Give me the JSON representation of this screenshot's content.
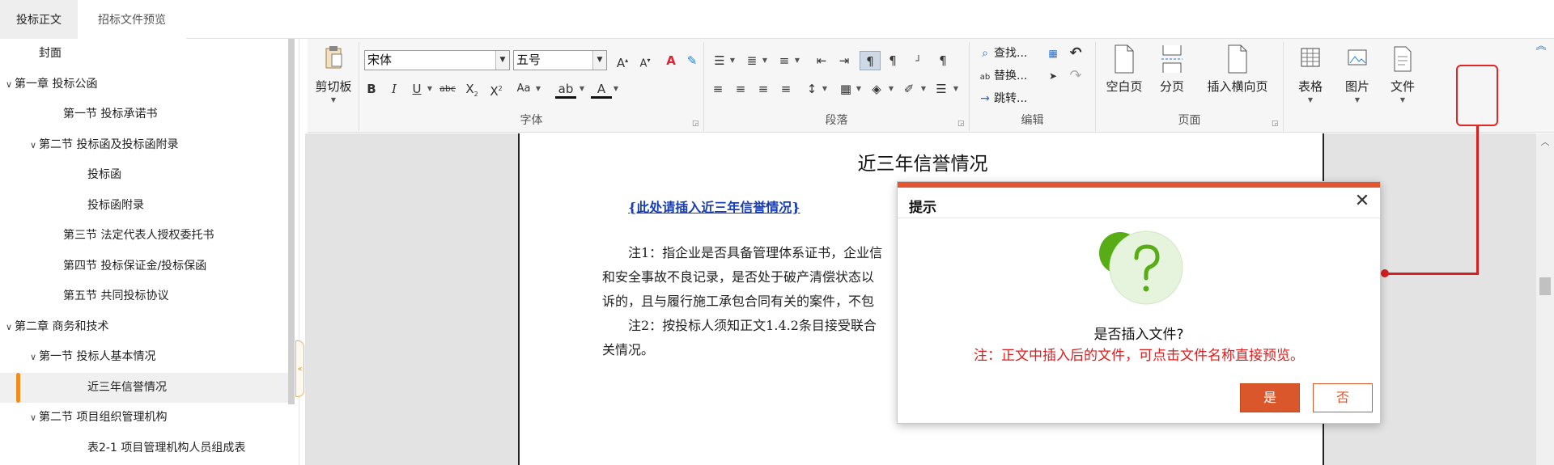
{
  "tabs": [
    "投标正文",
    "招标文件预览"
  ],
  "tree": [
    {
      "label": "封面",
      "level": 1,
      "expanded": null
    },
    {
      "label": "第一章 投标公函",
      "level": 0,
      "expanded": true
    },
    {
      "label": "第一节 投标承诺书",
      "level": 2,
      "expanded": null
    },
    {
      "label": "第二节 投标函及投标函附录",
      "level": 1,
      "expanded": true
    },
    {
      "label": "投标函",
      "level": 3,
      "expanded": null
    },
    {
      "label": "投标函附录",
      "level": 3,
      "expanded": null
    },
    {
      "label": "第三节 法定代表人授权委托书",
      "level": 2,
      "expanded": null
    },
    {
      "label": "第四节 投标保证金/投标保函",
      "level": 2,
      "expanded": null
    },
    {
      "label": "第五节 共同投标协议",
      "level": 2,
      "expanded": null
    },
    {
      "label": "第二章 商务和技术",
      "level": 0,
      "expanded": true
    },
    {
      "label": "第一节 投标人基本情况",
      "level": 1,
      "expanded": true
    },
    {
      "label": "近三年信誉情况",
      "level": 3,
      "expanded": null,
      "active": true
    },
    {
      "label": "第二节 项目组织管理机构",
      "level": 1,
      "expanded": true
    },
    {
      "label": "表2-1 项目管理机构人员组成表",
      "level": 3,
      "expanded": null
    }
  ],
  "ribbon": {
    "clipboard": {
      "label": "剪切板"
    },
    "font": {
      "title": "字体",
      "font_name": "宋体",
      "font_size": "五号"
    },
    "paragraph": {
      "title": "段落"
    },
    "edit": {
      "title": "编辑",
      "find": "查找...",
      "replace": "替换...",
      "goto": "跳转..."
    },
    "page": {
      "title": "页面",
      "blank": "空白页",
      "break": "分页",
      "landscape": "插入横向页"
    },
    "insert": {
      "table": "表格",
      "image": "图片",
      "file": "文件"
    }
  },
  "document": {
    "title": "近三年信誉情况",
    "placeholder_link": "{此处请插入近三年信誉情况}",
    "lines": [
      "注1：指企业是否具备管理体系证书，企业信",
      "和安全事故不良记录，是否处于破产清偿状态以",
      "诉的，且与履行施工承包合同有关的案件，不包",
      "注2：按投标人须知正文1.4.2条目接受联合",
      "关情况。"
    ]
  },
  "dialog": {
    "title": "提示",
    "close": "✕",
    "question": "是否插入文件?",
    "note": "注：正文中插入后的文件，可点击文件名称直接预览。",
    "yes": "是",
    "no": "否"
  },
  "colors": {
    "accent": "#d9572a",
    "warning": "#e01c1c",
    "active_marker": "#f08d1d",
    "icon_green": "#58ad17"
  }
}
